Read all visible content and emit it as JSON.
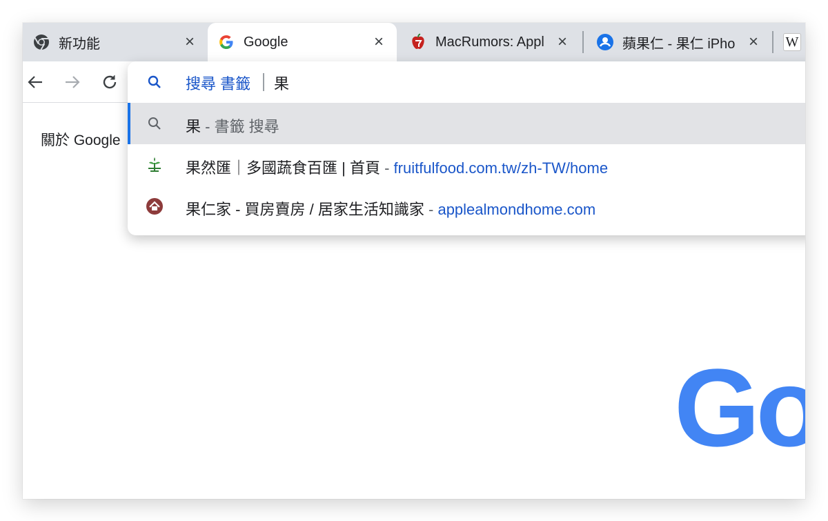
{
  "tabs": [
    {
      "title": "新功能",
      "favicon": "chrome-icon"
    },
    {
      "title": "Google",
      "favicon": "google-g-icon",
      "active": true
    },
    {
      "title": "MacRumors: Appl",
      "favicon": "macrumors-apple-icon"
    },
    {
      "title": "蘋果仁 - 果仁 iPho",
      "favicon": "applealmond-person-icon"
    },
    {
      "title": "W",
      "favicon": "wikipedia-icon"
    }
  ],
  "page": {
    "about_link": "關於 Google",
    "logo_partial": "Go"
  },
  "omnibox": {
    "keyword": "搜尋 書籤",
    "query": "果",
    "suggestions": [
      {
        "main": "果",
        "sub": " - 書籤 搜尋",
        "url": "",
        "icon": "search-icon",
        "selected": true
      },
      {
        "main": "果然匯｜多國蔬食百匯 | 首頁",
        "sub": " - ",
        "url": "fruitfulfood.com.tw/zh-TW/home",
        "icon": "fruitfulfood-icon"
      },
      {
        "main": "果仁家 - 買房賣房 / 居家生活知識家",
        "sub": " - ",
        "url": "applealmondhome.com",
        "icon": "applealmondhome-icon"
      }
    ]
  },
  "colors": {
    "tabstrip_bg": "#dee1e6",
    "link_blue": "#1a56c9",
    "selection_bar": "#1a73e8",
    "google_blue": "#4285f4",
    "google_red": "#ea4335"
  }
}
